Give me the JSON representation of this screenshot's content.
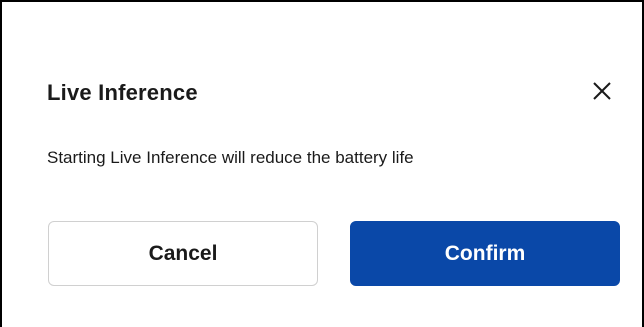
{
  "dialog": {
    "title": "Live Inference",
    "message": "Starting Live Inference will reduce the battery life",
    "close_icon": "close-icon",
    "cancel_label": "Cancel",
    "confirm_label": "Confirm"
  },
  "colors": {
    "primary": "#0a48a8",
    "text": "#1a1a1a",
    "border": "#d0d0d0"
  }
}
